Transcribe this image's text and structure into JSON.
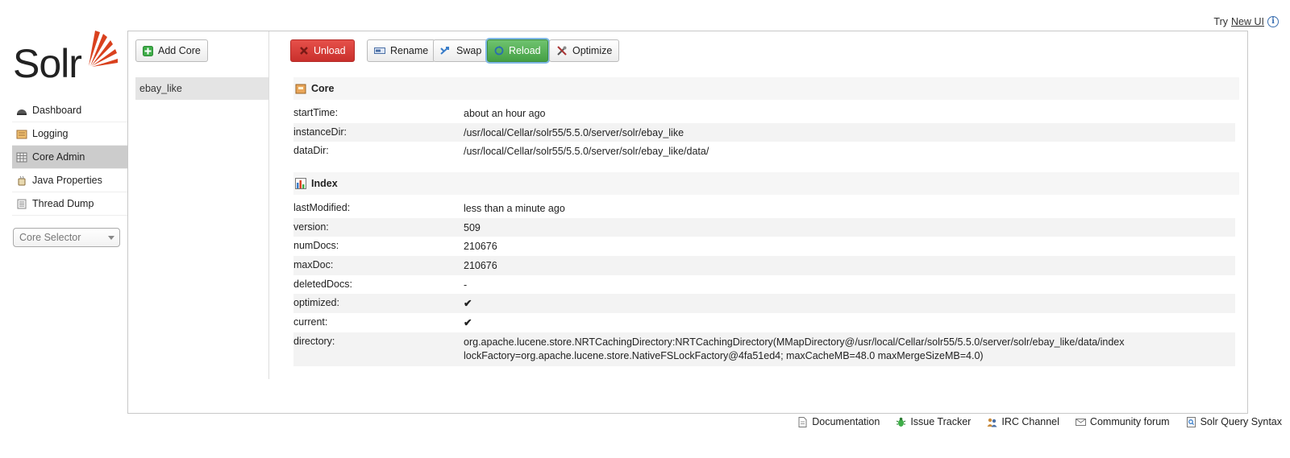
{
  "topbar": {
    "try_label": "Try",
    "new_ui_link": "New UI",
    "info_icon": "info-icon"
  },
  "logo": {
    "text": "Solr"
  },
  "nav": {
    "items": [
      {
        "label": "Dashboard",
        "icon": "dashboard-icon"
      },
      {
        "label": "Logging",
        "icon": "logging-icon"
      },
      {
        "label": "Core Admin",
        "icon": "core-admin-icon",
        "active": true
      },
      {
        "label": "Java Properties",
        "icon": "java-properties-icon"
      },
      {
        "label": "Thread Dump",
        "icon": "thread-dump-icon"
      }
    ]
  },
  "core_selector": {
    "placeholder": "Core Selector"
  },
  "cores": {
    "add_label": "Add Core",
    "items": [
      "ebay_like"
    ]
  },
  "toolbar": {
    "unload": "Unload",
    "rename": "Rename",
    "swap": "Swap",
    "reload": "Reload",
    "optimize": "Optimize"
  },
  "core_section": {
    "title": "Core",
    "rows": [
      {
        "key": "startTime:",
        "value": "about an hour ago"
      },
      {
        "key": "instanceDir:",
        "value": "/usr/local/Cellar/solr55/5.5.0/server/solr/ebay_like"
      },
      {
        "key": "dataDir:",
        "value": "/usr/local/Cellar/solr55/5.5.0/server/solr/ebay_like/data/"
      }
    ]
  },
  "index_section": {
    "title": "Index",
    "rows": [
      {
        "key": "lastModified:",
        "value": "less than a minute ago"
      },
      {
        "key": "version:",
        "value": "509"
      },
      {
        "key": "numDocs:",
        "value": "210676"
      },
      {
        "key": "maxDoc:",
        "value": "210676"
      },
      {
        "key": "deletedDocs:",
        "value": "-"
      },
      {
        "key": "optimized:",
        "value": "✔"
      },
      {
        "key": "current:",
        "value": "✔"
      },
      {
        "key": "directory:",
        "value": "org.apache.lucene.store.NRTCachingDirectory:NRTCachingDirectory(MMapDirectory@/usr/local/Cellar/solr55/5.5.0/server/solr/ebay_like/data/index lockFactory=org.apache.lucene.store.NativeFSLockFactory@4fa51ed4; maxCacheMB=48.0 maxMergeSizeMB=4.0)"
      }
    ]
  },
  "footer": {
    "links": [
      {
        "label": "Documentation",
        "icon": "documentation-icon"
      },
      {
        "label": "Issue Tracker",
        "icon": "bug-icon"
      },
      {
        "label": "IRC Channel",
        "icon": "irc-icon"
      },
      {
        "label": "Community forum",
        "icon": "mail-icon"
      },
      {
        "label": "Solr Query Syntax",
        "icon": "query-syntax-icon"
      }
    ]
  },
  "colors": {
    "unload": "#d9534f",
    "reload": "#5cb85c",
    "solr_accent": "#d9411e"
  }
}
